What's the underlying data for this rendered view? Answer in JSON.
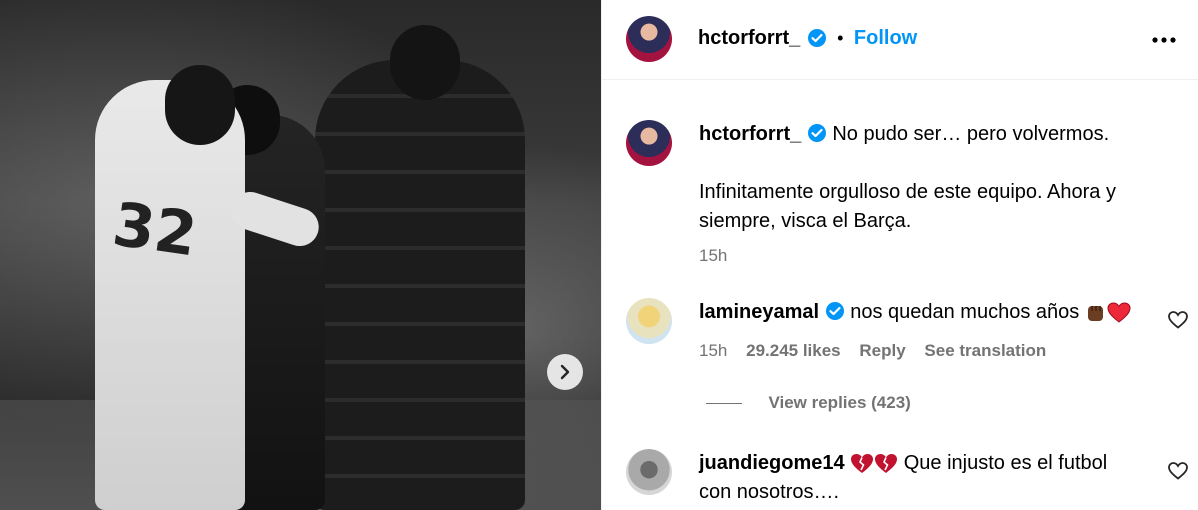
{
  "post_owner": {
    "username": "hctorforrt_",
    "separator": "•",
    "follow_label": "Follow"
  },
  "caption": {
    "username": "hctorforrt_",
    "line1": "No pudo ser… pero volvermos.",
    "line2": "Infinitamente orgulloso de este equipo. Ahora y",
    "line3": "siempre, visca el Barça.",
    "time": "15h"
  },
  "comments": [
    {
      "username": "lamineyamal",
      "text": "nos quedan muchos años",
      "time": "15h",
      "likes": "29.245 likes",
      "reply_label": "Reply",
      "translate_label": "See translation",
      "view_replies": "View replies (423)"
    },
    {
      "username": "juandiegome14",
      "text_line1": "Que injusto es el futbol",
      "text_line2": "con nosotros…."
    }
  ],
  "photo": {
    "jersey_number": "32"
  },
  "colors": {
    "accent": "#0095f6",
    "muted": "#737373",
    "heart_red": "#ed2939",
    "broken_heart": "#c1122f"
  }
}
